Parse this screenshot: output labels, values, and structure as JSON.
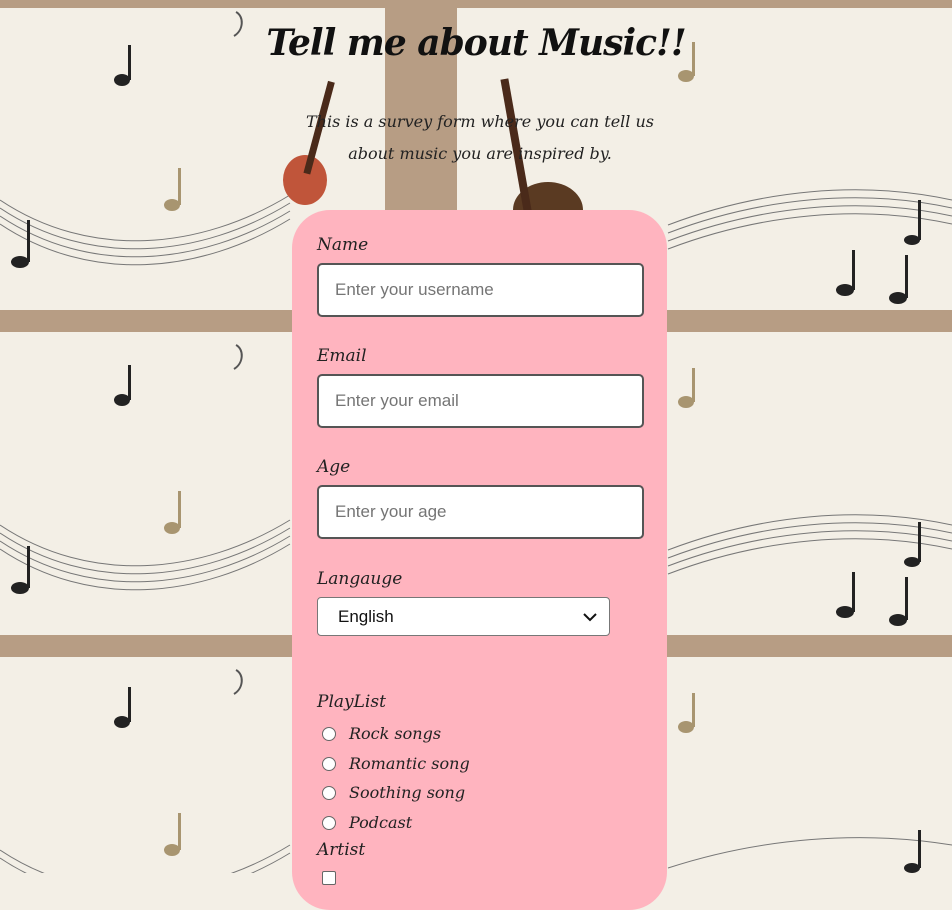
{
  "page": {
    "title": "Tell me about Music!!",
    "subtitle": "This is a survey form where you can tell us about music you are inspired by."
  },
  "form": {
    "name": {
      "label": "Name",
      "placeholder": "Enter your username"
    },
    "email": {
      "label": "Email",
      "placeholder": "Enter your email"
    },
    "age": {
      "label": "Age",
      "placeholder": "Enter your age"
    },
    "language": {
      "label": "Langauge",
      "selected": "English"
    },
    "playlist": {
      "label": "PlayList",
      "options": [
        "Rock songs",
        "Romantic song",
        "Soothing song",
        "Podcast"
      ]
    },
    "artist": {
      "label": "Artist"
    }
  },
  "colors": {
    "card": "#ffb4bf",
    "background": "#f3efe6",
    "frame": "#b79d84"
  },
  "icons": {
    "select_arrow": "chevron-down-icon",
    "decoration": "music-note-icon"
  }
}
